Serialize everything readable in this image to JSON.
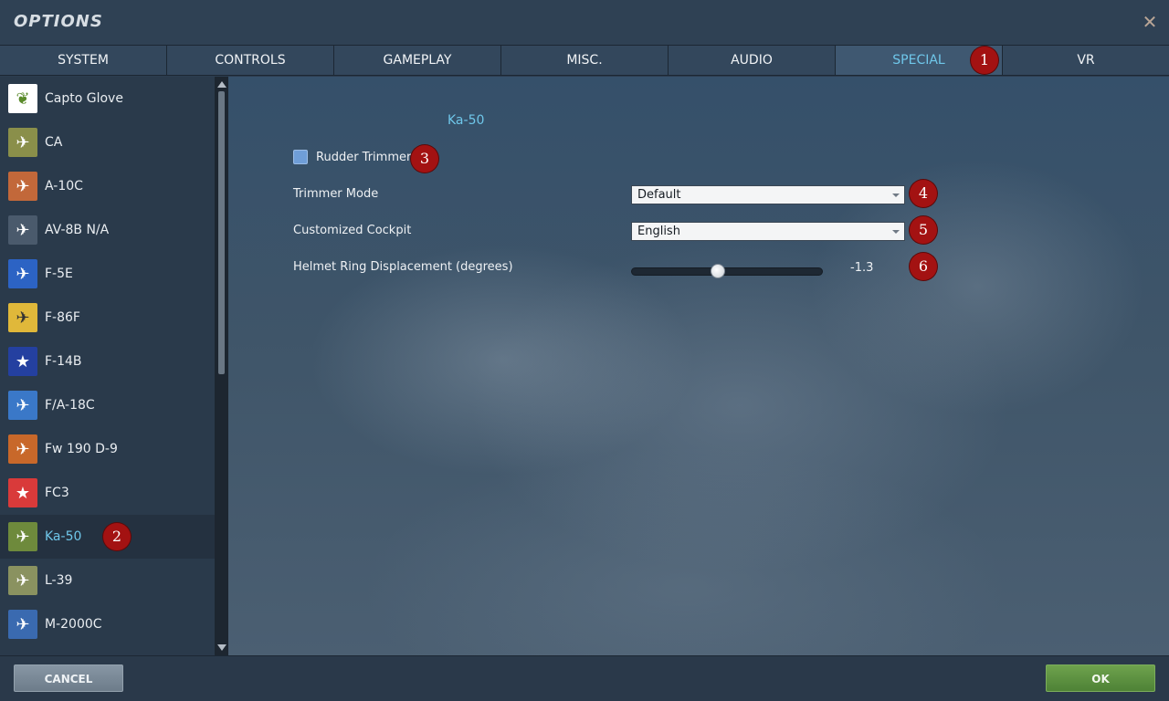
{
  "window": {
    "title": "OPTIONS",
    "close_symbol": "✕"
  },
  "tabs": [
    {
      "label": "SYSTEM",
      "active": false
    },
    {
      "label": "CONTROLS",
      "active": false
    },
    {
      "label": "GAMEPLAY",
      "active": false
    },
    {
      "label": "MISC.",
      "active": false
    },
    {
      "label": "AUDIO",
      "active": false
    },
    {
      "label": "SPECIAL",
      "active": true
    },
    {
      "label": "VR",
      "active": false
    }
  ],
  "sidebar": {
    "items": [
      {
        "label": "Capto Glove",
        "icon": "capto-glove-icon",
        "color": "#ffffff"
      },
      {
        "label": "CA",
        "icon": "ca-icon",
        "color": "#8a8f4a"
      },
      {
        "label": "A-10C",
        "icon": "a10c-icon",
        "color": "#c2683a"
      },
      {
        "label": "AV-8B N/A",
        "icon": "av8b-icon",
        "color": "#4a5a6c"
      },
      {
        "label": "F-5E",
        "icon": "f5e-icon",
        "color": "#2c63c4"
      },
      {
        "label": "F-86F",
        "icon": "f86f-icon",
        "color": "#e0b83a"
      },
      {
        "label": "F-14B",
        "icon": "f14b-icon",
        "color": "#2440a0"
      },
      {
        "label": "F/A-18C",
        "icon": "fa18c-icon",
        "color": "#3a78c8"
      },
      {
        "label": "Fw 190 D-9",
        "icon": "fw190-icon",
        "color": "#c8682a"
      },
      {
        "label": "FC3",
        "icon": "fc3-icon",
        "color": "#d93a3a"
      },
      {
        "label": "Ka-50",
        "icon": "ka50-icon",
        "color": "#6e8a3c",
        "selected": true
      },
      {
        "label": "L-39",
        "icon": "l39-icon",
        "color": "#8a9260"
      },
      {
        "label": "M-2000C",
        "icon": "m2000c-icon",
        "color": "#3a6ab0"
      }
    ]
  },
  "main": {
    "module_title": "Ka-50",
    "rudder_trimmer": {
      "label": "Rudder Trimmer",
      "checked": true
    },
    "trimmer_mode": {
      "label": "Trimmer Mode",
      "value": "Default"
    },
    "customized_cockpit": {
      "label": "Customized Cockpit",
      "value": "English"
    },
    "helmet_ring": {
      "label": "Helmet Ring Displacement (degrees)",
      "value": "-1.3",
      "fraction": 0.45
    }
  },
  "markers": [
    "1",
    "2",
    "3",
    "4",
    "5",
    "6"
  ],
  "footer": {
    "cancel_label": "CANCEL",
    "ok_label": "OK"
  },
  "colors": {
    "accent": "#6fc7ea",
    "marker": "#a31212",
    "ok": "#5a8f3f",
    "cancel": "#7a8896"
  }
}
